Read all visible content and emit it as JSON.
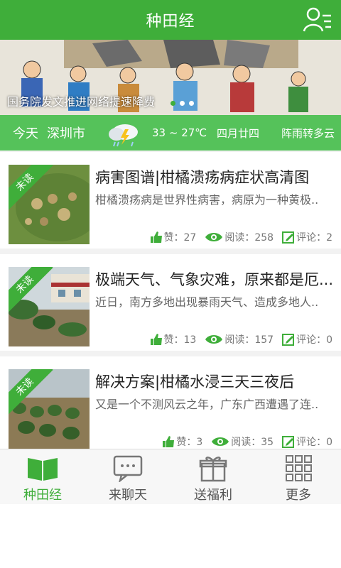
{
  "header": {
    "title": "种田经"
  },
  "banner": {
    "caption": "国务院发文推进网络提速降费"
  },
  "weather": {
    "today": "今天",
    "city": "深圳市",
    "temp": "33 ~ 27℃",
    "lunar_date": "四月廿四",
    "desc": "阵雨转多云",
    "icon": "thunderstorm-icon"
  },
  "articles": [
    {
      "badge": "未读",
      "title": "病害图谱|柑橘溃疡病症状高清图",
      "summary": "柑橘溃疡病是世界性病害，病原为一种黄极..",
      "likes_label": "赞：27",
      "reads_label": "阅读：258",
      "comments_label": "评论：2"
    },
    {
      "badge": "未读",
      "title": "极端天气、气象灾难，原来都是厄...",
      "summary": "近日，南方多地出现暴雨天气、造成多地人..",
      "likes_label": "赞：13",
      "reads_label": "阅读：157",
      "comments_label": "评论：0"
    },
    {
      "badge": "未读",
      "title": "解决方案|柑橘水浸三天三夜后",
      "summary": "又是一个不测风云之年，广东广西遭遇了连..",
      "likes_label": "赞：3",
      "reads_label": "阅读：35",
      "comments_label": "评论：0"
    }
  ],
  "nav": [
    {
      "label": "种田经",
      "icon": "book-icon"
    },
    {
      "label": "来聊天",
      "icon": "chat-icon"
    },
    {
      "label": "送福利",
      "icon": "gift-icon"
    },
    {
      "label": "更多",
      "icon": "grid-icon"
    }
  ],
  "colors": {
    "brand": "#3fae3a",
    "weather_bar": "#55c25a",
    "stat_icon": "#3fae3a"
  }
}
